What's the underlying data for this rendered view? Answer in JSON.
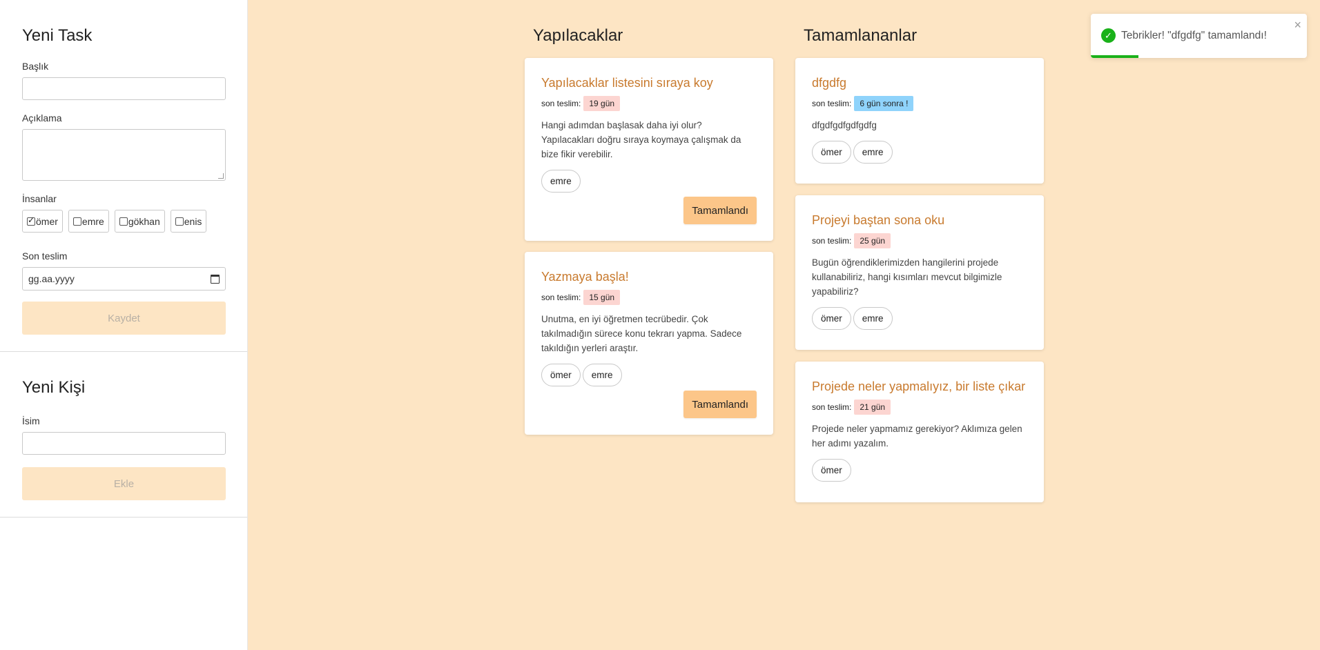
{
  "sidebar": {
    "task_form": {
      "title": "Yeni Task",
      "title_label": "Başlık",
      "description_label": "Açıklama",
      "people_label": "İnsanlar",
      "people": [
        {
          "name": "ömer",
          "checked": true
        },
        {
          "name": "emre",
          "checked": false
        },
        {
          "name": "gökhan",
          "checked": false
        },
        {
          "name": "enis",
          "checked": false
        }
      ],
      "deadline_label": "Son teslim",
      "deadline_placeholder": "gg.aa.yyyy",
      "save_label": "Kaydet"
    },
    "person_form": {
      "title": "Yeni Kişi",
      "name_label": "İsim",
      "add_label": "Ekle"
    }
  },
  "todo": {
    "title": "Yapılacaklar",
    "cards": [
      {
        "title": "Yapılacaklar listesini sıraya koy",
        "deadline_label": "son teslim:",
        "deadline": "19 gün",
        "description": "Hangi adımdan başlasak daha iyi olur? Yapılacakları doğru sıraya koymaya çalışmak da bize fikir verebilir.",
        "people": [
          "emre"
        ],
        "done_label": "Tamamlandı"
      },
      {
        "title": "Yazmaya başla!",
        "deadline_label": "son teslim:",
        "deadline": "15 gün",
        "description": "Unutma, en iyi öğretmen tecrübedir. Çok takılmadığın sürece konu tekrarı yapma. Sadece takıldığın yerleri araştır.",
        "people": [
          "ömer",
          "emre"
        ],
        "done_label": "Tamamlandı"
      }
    ]
  },
  "done": {
    "title": "Tamamlananlar",
    "cards": [
      {
        "title": "dfgdfg",
        "deadline_label": "son teslim:",
        "deadline": "6 gün sonra !",
        "deadline_color": "#8fd3fb",
        "description": "dfgdfgdfgdfgdfg",
        "people": [
          "ömer",
          "emre"
        ]
      },
      {
        "title": "Projeyi baştan sona oku",
        "deadline_label": "son teslim:",
        "deadline": "25 gün",
        "description": "Bugün öğrendiklerimizden hangilerini projede kullanabiliriz, hangi kısımları mevcut bilgimizle yapabiliriz?",
        "people": [
          "ömer",
          "emre"
        ]
      },
      {
        "title": "Projede neler yapmalıyız, bir liste çıkar",
        "deadline_label": "son teslim:",
        "deadline": "21 gün",
        "description": "Projede neler yapmamız gerekiyor? Aklımıza gelen her adımı yazalım.",
        "people": [
          "ömer"
        ]
      }
    ]
  },
  "toast": {
    "message": "Tebrikler! \"dfgdfg\" tamamlandı!",
    "icon": "check-circle-icon",
    "close_icon": "close-icon",
    "progress": 0.22
  },
  "colors": {
    "background": "#fde5c4",
    "card_title": "#c87a2e",
    "button": "#fcc689",
    "badge": "#fcd5d1",
    "badge_blue": "#8fd3fb",
    "success": "#1ab11a"
  }
}
